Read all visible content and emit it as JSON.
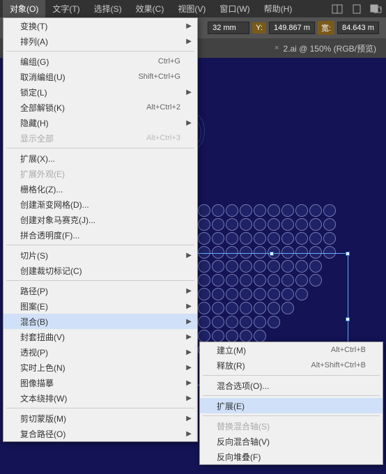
{
  "menubar": [
    {
      "label": "对象(O)",
      "active": true
    },
    {
      "label": "文字(T)"
    },
    {
      "label": "选择(S)"
    },
    {
      "label": "效果(C)"
    },
    {
      "label": "视图(V)"
    },
    {
      "label": "窗口(W)"
    },
    {
      "label": "帮助(H)"
    }
  ],
  "options_bar": {
    "x_unit": "32 mm",
    "y_label": "Y:",
    "y_value": "149.867 m",
    "w_label": "宽:",
    "w_value": "84.643 m"
  },
  "tabs": [
    {
      "title": "2.ai @ 150% (RGB/预览)",
      "close": "×"
    }
  ],
  "dropdown_main": {
    "groups": [
      [
        {
          "label": "变换(T)",
          "arrow": true
        },
        {
          "label": "排列(A)",
          "arrow": true
        }
      ],
      [
        {
          "label": "编组(G)",
          "shortcut": "Ctrl+G"
        },
        {
          "label": "取消编组(U)",
          "shortcut": "Shift+Ctrl+G"
        },
        {
          "label": "锁定(L)",
          "arrow": true
        },
        {
          "label": "全部解锁(K)",
          "shortcut": "Alt+Ctrl+2"
        },
        {
          "label": "隐藏(H)",
          "arrow": true
        },
        {
          "label": "显示全部",
          "shortcut": "Alt+Ctrl+3",
          "disabled": true
        }
      ],
      [
        {
          "label": "扩展(X)..."
        },
        {
          "label": "扩展外观(E)",
          "disabled": true
        },
        {
          "label": "栅格化(Z)..."
        },
        {
          "label": "创建渐变网格(D)..."
        },
        {
          "label": "创建对象马赛克(J)..."
        },
        {
          "label": "拼合透明度(F)..."
        }
      ],
      [
        {
          "label": "切片(S)",
          "arrow": true
        },
        {
          "label": "创建裁切标记(C)"
        }
      ],
      [
        {
          "label": "路径(P)",
          "arrow": true
        },
        {
          "label": "图案(E)",
          "arrow": true
        },
        {
          "label": "混合(B)",
          "arrow": true,
          "highlighted": true
        },
        {
          "label": "封套扭曲(V)",
          "arrow": true
        },
        {
          "label": "透视(P)",
          "arrow": true
        },
        {
          "label": "实时上色(N)",
          "arrow": true
        },
        {
          "label": "图像描摹",
          "arrow": true
        },
        {
          "label": "文本绕排(W)",
          "arrow": true
        }
      ],
      [
        {
          "label": "剪切蒙版(M)",
          "arrow": true
        },
        {
          "label": "复合路径(O)",
          "arrow": true
        }
      ]
    ]
  },
  "dropdown_sub": {
    "groups": [
      [
        {
          "label": "建立(M)",
          "shortcut": "Alt+Ctrl+B"
        },
        {
          "label": "释放(R)",
          "shortcut": "Alt+Shift+Ctrl+B"
        }
      ],
      [
        {
          "label": "混合选项(O)..."
        }
      ],
      [
        {
          "label": "扩展(E)",
          "highlighted": true
        }
      ],
      [
        {
          "label": "替换混合轴(S)",
          "disabled": true
        },
        {
          "label": "反向混合轴(V)"
        },
        {
          "label": "反向堆叠(F)"
        }
      ]
    ]
  }
}
